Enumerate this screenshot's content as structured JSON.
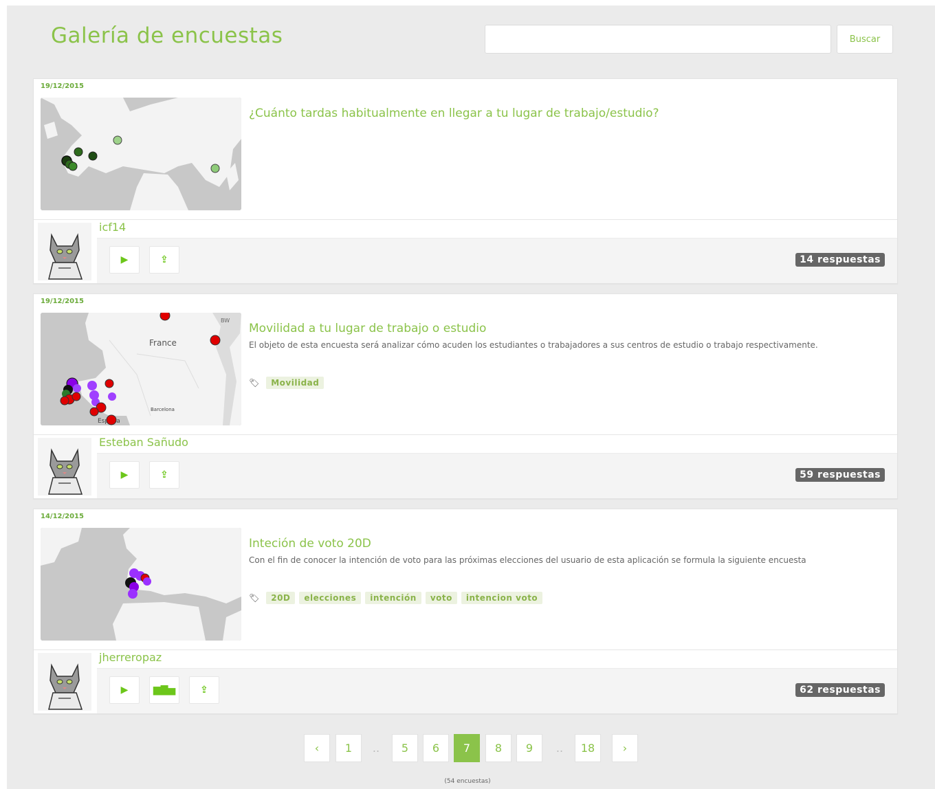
{
  "header": {
    "title": "Galería de encuestas",
    "search_placeholder": "",
    "search_button": "Buscar"
  },
  "surveys": [
    {
      "date": "19/12/2015",
      "title": "¿Cuánto tardas habitualmente en llegar a tu lugar de trabajo/estudio?",
      "description": "",
      "tags": [],
      "author": "icf14",
      "responses": "14 respuestas"
    },
    {
      "date": "19/12/2015",
      "title": "Movilidad a tu lugar de trabajo o estudio",
      "description": "El objeto de esta encuesta será analizar cómo acuden los estudiantes o trabajadores a sus centros de estudio o trabajo respectivamente.",
      "tags": [
        "Movilidad"
      ],
      "map_labels": [
        "France",
        "BW",
        "Barcelona",
        "España"
      ],
      "author": "Esteban Sañudo",
      "responses": "59 respuestas"
    },
    {
      "date": "14/12/2015",
      "title": "Inteción de voto 20D",
      "description": "Con el fin de conocer la intención de voto para las próximas elecciones del usuario de esta aplicación se formula la siguiente encuesta",
      "tags": [
        "20D",
        "elecciones",
        "intención",
        "voto",
        "intencion voto"
      ],
      "author": "jherreropaz",
      "responses": "62 respuestas"
    }
  ],
  "icons": {
    "play": "play-icon",
    "share": "share-icon",
    "chart": "bar-chart-icon",
    "tag": "tag-icon",
    "avatar": "cat-avatar"
  },
  "pagination": {
    "prev": "‹",
    "next": "›",
    "pages": [
      "1",
      "..",
      "5",
      "6",
      "7",
      "8",
      "9",
      "..",
      "18"
    ],
    "active": "7",
    "total": "(54 encuestas)"
  },
  "colors": {
    "accent": "#8bc34a",
    "badge": "#666666",
    "background": "#ebebeb"
  }
}
